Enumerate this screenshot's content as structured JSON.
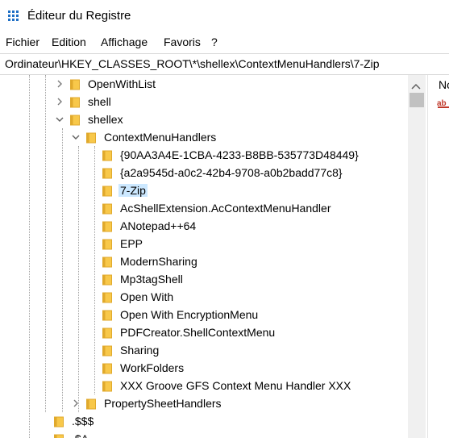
{
  "window": {
    "title": "Éditeur du Registre",
    "app_icon": "registry-editor-icon",
    "accent": "#1f6fc5"
  },
  "menu": [
    "Fichier",
    "Edition",
    "Affichage",
    "Favoris",
    "?"
  ],
  "address": "Ordinateur\\HKEY_CLASSES_ROOT\\*\\shellex\\ContextMenuHandlers\\7-Zip",
  "tree": [
    {
      "label": "OpenWithList",
      "expander": "collapsed"
    },
    {
      "label": "shell",
      "expander": "collapsed"
    },
    {
      "label": "shellex",
      "expander": "expanded"
    },
    {
      "label": "ContextMenuHandlers",
      "expander": "expanded"
    },
    {
      "label": "{90AA3A4E-1CBA-4233-B8BB-535773D48449}",
      "expander": "none"
    },
    {
      "label": "{a2a9545d-a0c2-42b4-9708-a0b2badd77c8}",
      "expander": "none"
    },
    {
      "label": "7-Zip",
      "expander": "none",
      "selected": true
    },
    {
      "label": "AcShellExtension.AcContextMenuHandler",
      "expander": "none"
    },
    {
      "label": "ANotepad++64",
      "expander": "none"
    },
    {
      "label": "EPP",
      "expander": "none"
    },
    {
      "label": "ModernSharing",
      "expander": "none"
    },
    {
      "label": "Mp3tagShell",
      "expander": "none"
    },
    {
      "label": "Open With",
      "expander": "none"
    },
    {
      "label": "Open With EncryptionMenu",
      "expander": "none"
    },
    {
      "label": "PDFCreator.ShellContextMenu",
      "expander": "none"
    },
    {
      "label": "Sharing",
      "expander": "none"
    },
    {
      "label": "WorkFolders",
      "expander": "none"
    },
    {
      "label": "XXX Groove GFS Context Menu Handler XXX",
      "expander": "none"
    },
    {
      "label": "PropertySheetHandlers",
      "expander": "collapsed"
    },
    {
      "label": ".$$$",
      "expander": "none"
    },
    {
      "label": ".$A",
      "expander": "none"
    }
  ],
  "right_pane": {
    "column_header": "No",
    "value_icon": "string-value-ab-icon"
  },
  "colors": {
    "folder": "#f8c84a",
    "folder_dark": "#e0a92c",
    "selection": "#cce8ff"
  }
}
